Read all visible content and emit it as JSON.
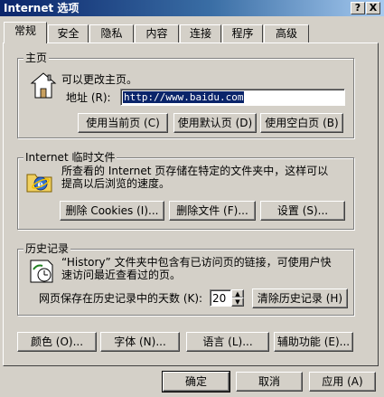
{
  "window": {
    "title": "Internet 选项",
    "help_glyph": "?",
    "close_glyph": "X"
  },
  "tabs": [
    {
      "label": "常规",
      "active": true
    },
    {
      "label": "安全"
    },
    {
      "label": "隐私"
    },
    {
      "label": "内容"
    },
    {
      "label": "连接"
    },
    {
      "label": "程序"
    },
    {
      "label": "高级"
    }
  ],
  "home": {
    "legend": "主页",
    "desc": "可以更改主页。",
    "address_label": "地址 (R):",
    "address_value": "http://www.baidu.com",
    "buttons": {
      "current": "使用当前页 (C)",
      "default": "使用默认页 (D)",
      "blank": "使用空白页 (B)"
    }
  },
  "temp": {
    "legend": "Internet 临时文件",
    "desc_line1": "所查看的 Internet 页存储在特定的文件夹中，这样可以",
    "desc_line2": "提高以后浏览的速度。",
    "buttons": {
      "cookies": "删除 Cookies (I)...",
      "files": "删除文件 (F)...",
      "settings": "设置 (S)..."
    }
  },
  "history": {
    "legend": "历史记录",
    "desc_line1": "“History” 文件夹中包含有已访问页的链接，可使用户快",
    "desc_line2": "速访问最近查看过的页。",
    "days_label": "网页保存在历史记录中的天数 (K):",
    "days_value": "20",
    "clear_button": "清除历史记录 (H)"
  },
  "bottom_buttons": {
    "colors": "颜色 (O)...",
    "fonts": "字体 (N)...",
    "languages": "语言 (L)...",
    "accessibility": "辅助功能 (E)..."
  },
  "dialog_buttons": {
    "ok": "确定",
    "cancel": "取消",
    "apply": "应用 (A)"
  }
}
